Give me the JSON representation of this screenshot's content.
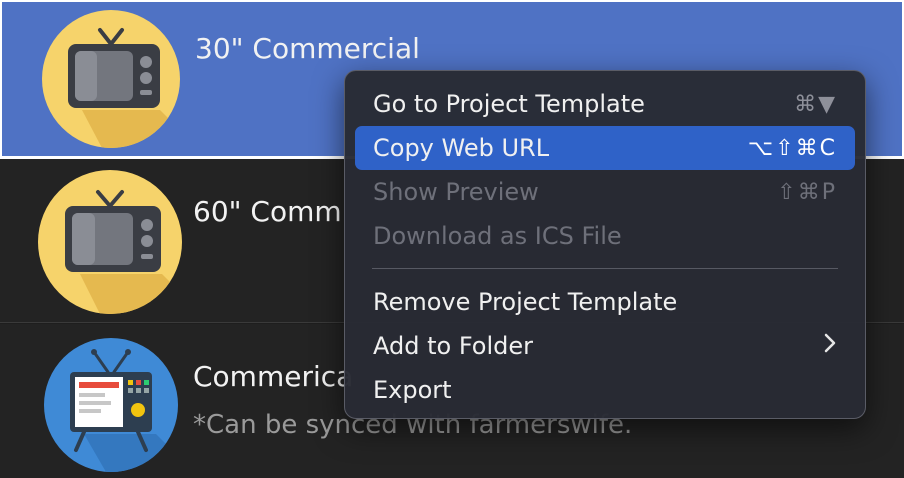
{
  "rows": [
    {
      "title": "30\" Commercial",
      "icon": "tv-icon",
      "accent": "#f6d36b",
      "state": "selected"
    },
    {
      "title": "60\" Comm",
      "icon": "tv-icon",
      "accent": "#f6d36b"
    },
    {
      "title": "Commerica",
      "subtitle": "*Can be synced with farmerswife.",
      "icon": "retro-tv-icon",
      "accent": "#3f8ad6"
    }
  ],
  "context_menu": {
    "items": [
      {
        "label": "Go to Project Template",
        "shortcut": "⌘▼",
        "state": "enabled"
      },
      {
        "label": "Copy Web URL",
        "shortcut": "⌥⇧⌘C",
        "state": "highlighted"
      },
      {
        "label": "Show Preview",
        "shortcut": "⇧⌘P",
        "state": "disabled"
      },
      {
        "label": "Download as ICS File",
        "shortcut": "",
        "state": "disabled"
      },
      {
        "label": "Remove Project Template",
        "shortcut": "",
        "state": "enabled"
      },
      {
        "label": "Add to Folder",
        "submenu": "chevron-right-icon",
        "state": "enabled"
      },
      {
        "label": "Export",
        "shortcut": "",
        "state": "enabled"
      }
    ]
  },
  "colors": {
    "selection": "#4f72c4",
    "menu_highlight": "#2f62c8",
    "background": "#232323"
  }
}
